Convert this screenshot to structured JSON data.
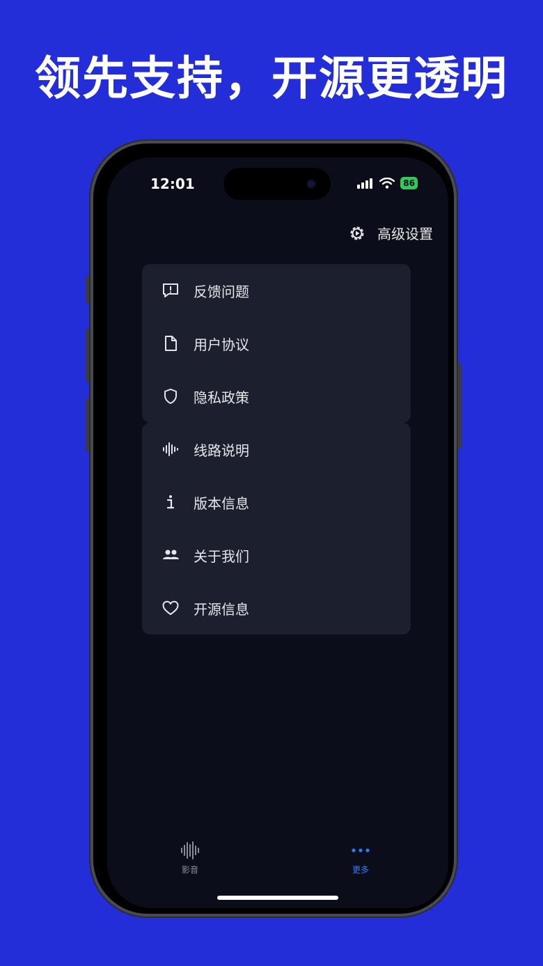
{
  "headline": "领先支持，开源更透明",
  "status_bar": {
    "time": "12:01",
    "battery": "86"
  },
  "header": {
    "advanced_settings": "高级设置"
  },
  "menu_groups": [
    {
      "items": [
        {
          "label": "反馈问题",
          "icon": "feedback-icon"
        },
        {
          "label": "用户协议",
          "icon": "document-icon"
        },
        {
          "label": "隐私政策",
          "icon": "shield-icon"
        }
      ]
    },
    {
      "items": [
        {
          "label": "线路说明",
          "icon": "waveform-icon"
        },
        {
          "label": "版本信息",
          "icon": "info-icon"
        },
        {
          "label": "关于我们",
          "icon": "people-icon"
        },
        {
          "label": "开源信息",
          "icon": "heart-icon"
        }
      ]
    }
  ],
  "tabbar": {
    "tabs": [
      {
        "label": "影音",
        "icon": "waveform-icon",
        "active": false
      },
      {
        "label": "更多",
        "icon": "more-dots-icon",
        "active": true
      }
    ]
  },
  "colors": {
    "background": "#232ed8",
    "screen": "#0b0e1a",
    "card": "#1c1f2d",
    "accent": "#2f7bf5",
    "battery": "#34c759"
  }
}
